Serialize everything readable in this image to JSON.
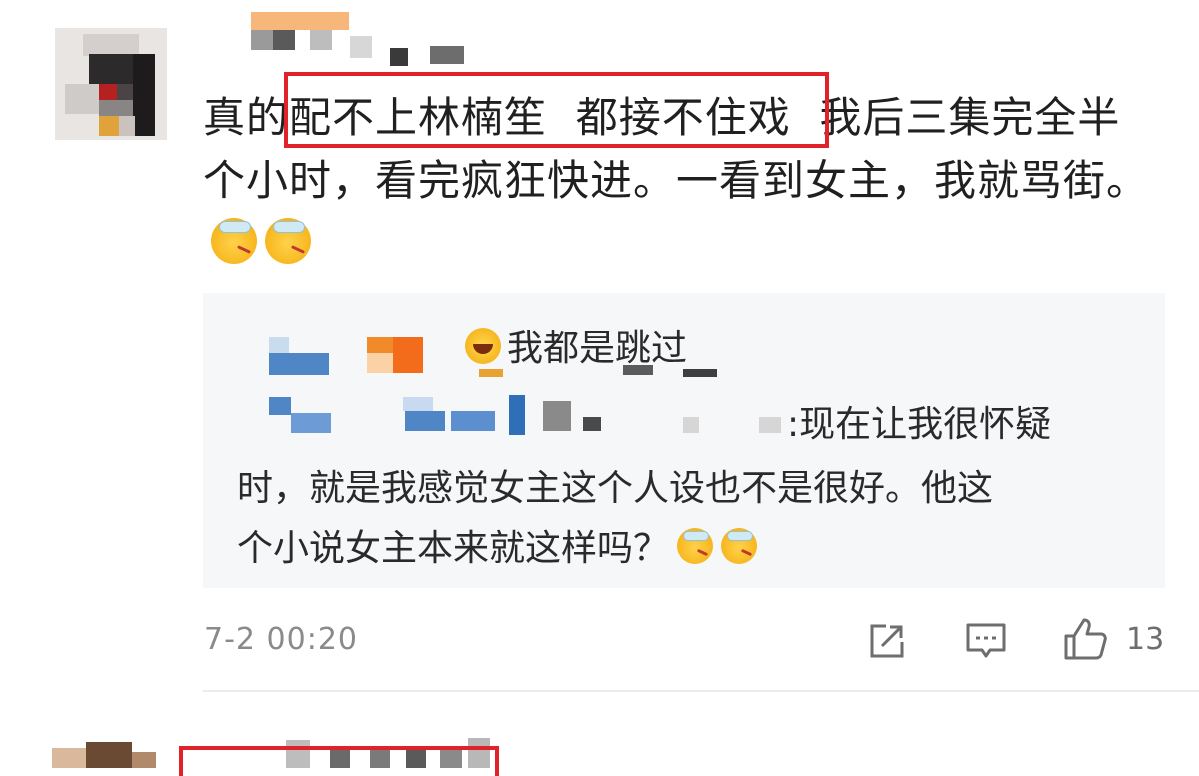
{
  "comment": {
    "text_before": "真的",
    "highlighted_text": "配不上林楠笙  都接不住戏",
    "text_after": "  我后三集完全半个小时，看完疯狂快进。一看到女主，我就骂街。"
  },
  "reply": {
    "line1": "我都是跳过",
    "line2_visible": ":现在让我很怀疑",
    "line3": "时，就是我感觉女主这个人设也不是很好。他这",
    "line4": "个小说女主本来就这样吗？"
  },
  "footer": {
    "timestamp": "7-2 00:20",
    "like_count": "13",
    "icons": [
      "share-icon",
      "comment-icon",
      "like-icon"
    ]
  },
  "colors": {
    "highlight_border": "#e0232b",
    "reply_background": "#f6f7f9",
    "footer_text": "#8a8a8a"
  }
}
